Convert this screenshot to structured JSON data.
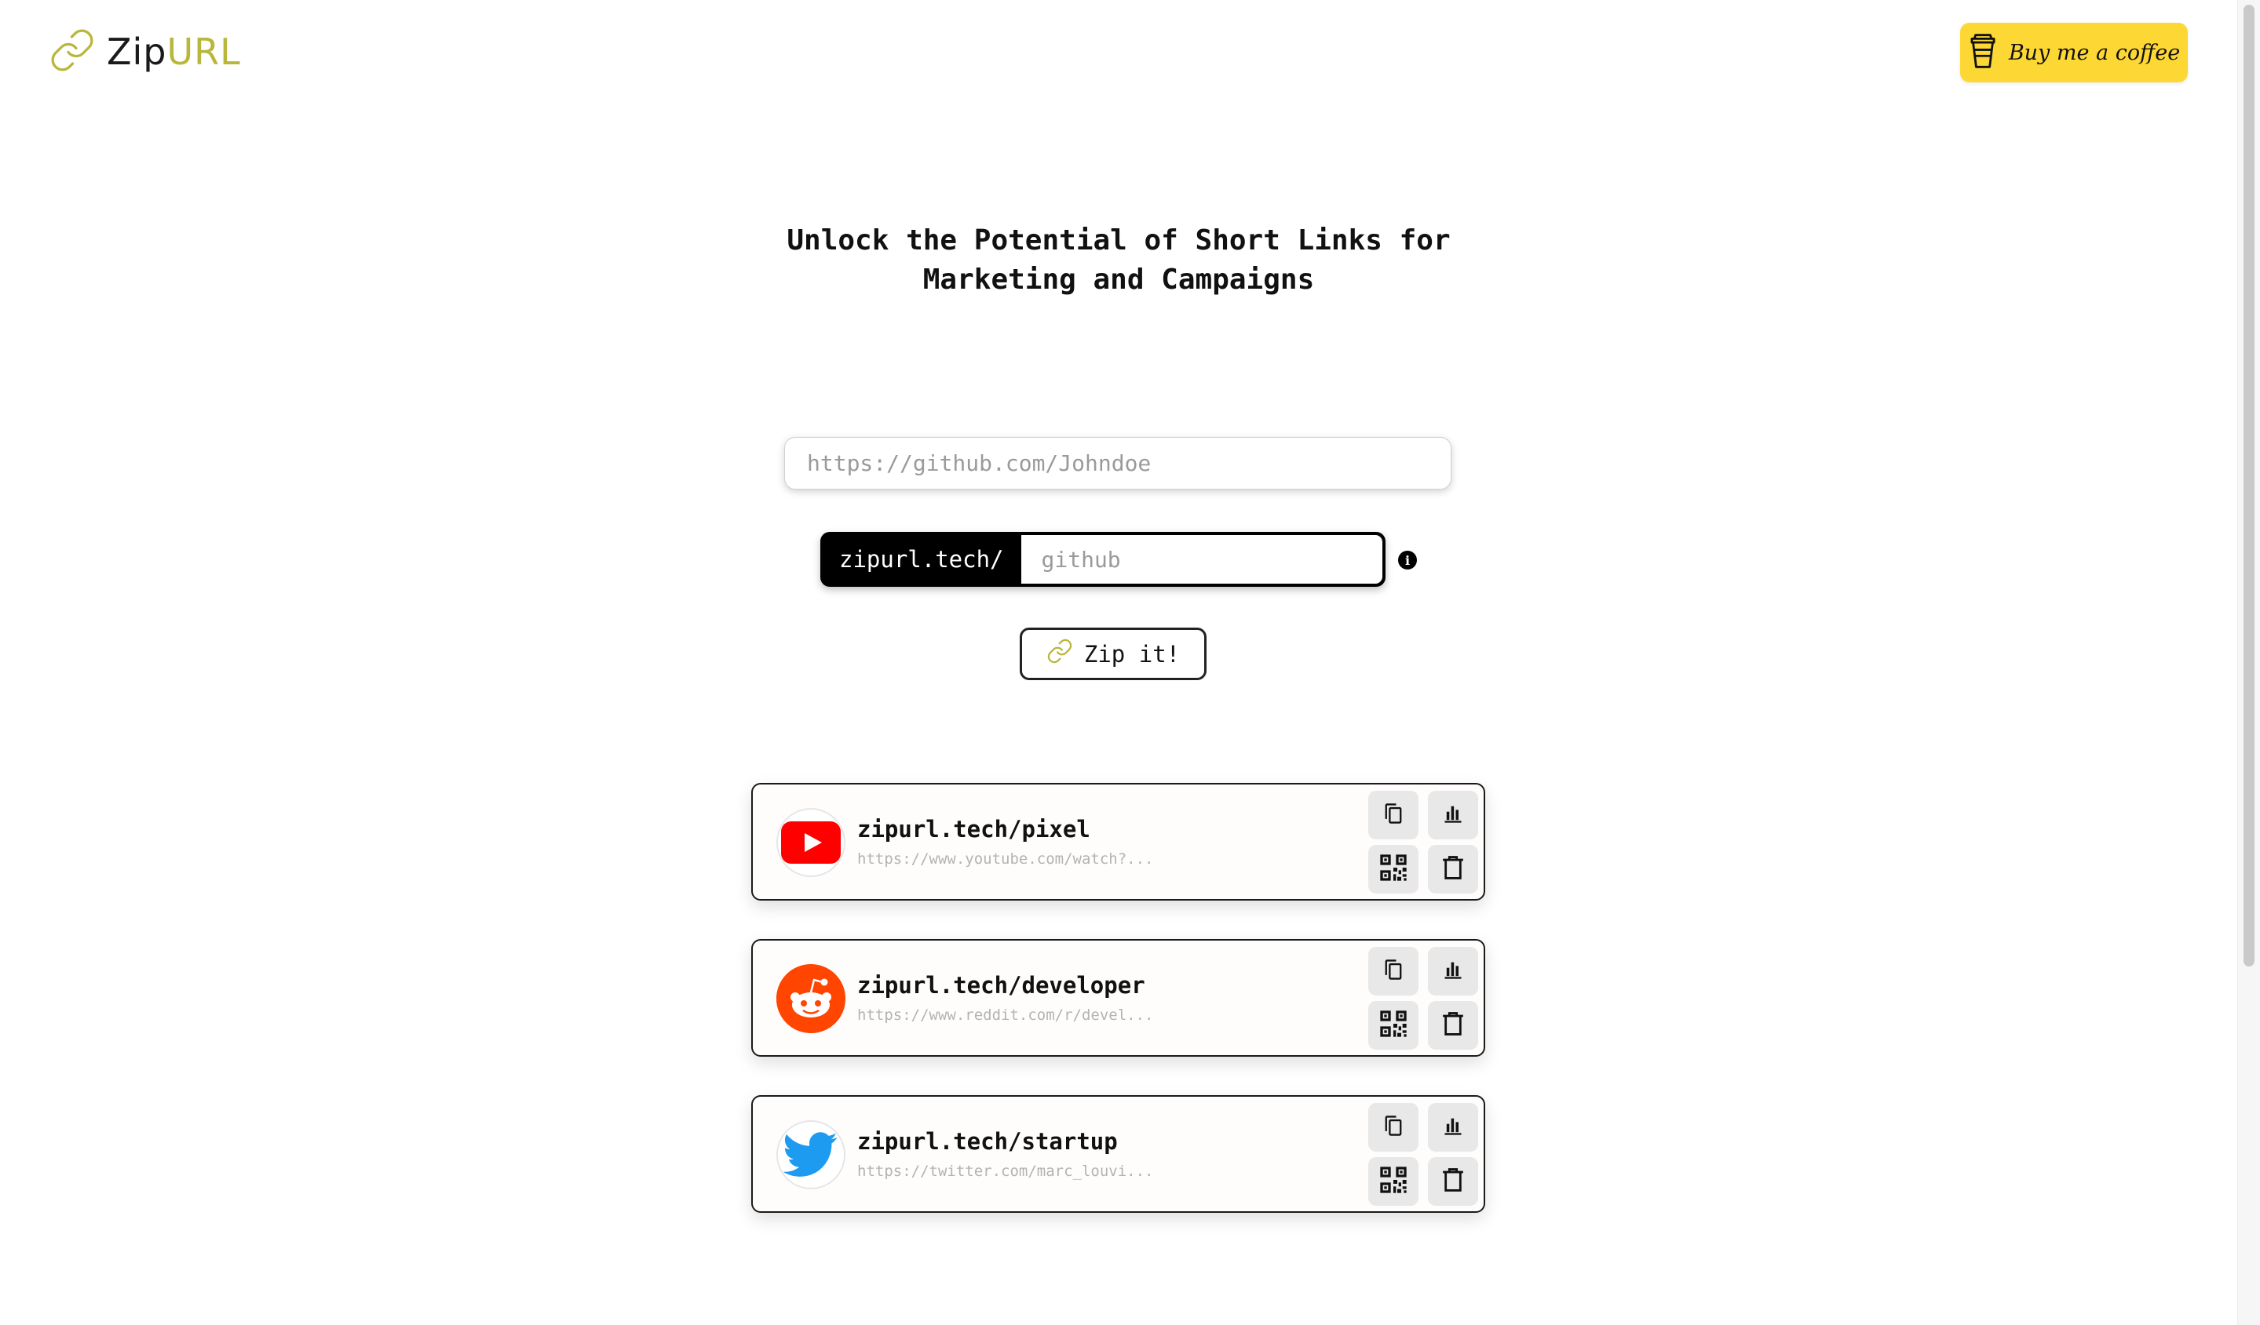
{
  "header": {
    "logo_primary": "Zip",
    "logo_accent": "URL",
    "coffee_label": "Buy me a coffee"
  },
  "hero": {
    "headline_line1": "Unlock the Potential of Short Links for",
    "headline_line2": "Marketing and Campaigns"
  },
  "form": {
    "url_placeholder": "https://github.com/Johndoe",
    "alias_prefix": "zipurl.tech/",
    "alias_placeholder": "github",
    "info_icon": "i",
    "submit_label": "Zip it!"
  },
  "links": [
    {
      "short": "zipurl.tech/pixel",
      "long": "https://www.youtube.com/watch?...",
      "icon": "youtube-icon"
    },
    {
      "short": "zipurl.tech/developer",
      "long": "https://www.reddit.com/r/devel...",
      "icon": "reddit-icon"
    },
    {
      "short": "zipurl.tech/startup",
      "long": "https://twitter.com/marc_louvi...",
      "icon": "twitter-icon"
    }
  ],
  "colors": {
    "accent": "#b9b63c",
    "coffee": "#fdd835",
    "youtube": "#ff0000",
    "reddit": "#ff4500",
    "twitter": "#1d9bf0"
  }
}
